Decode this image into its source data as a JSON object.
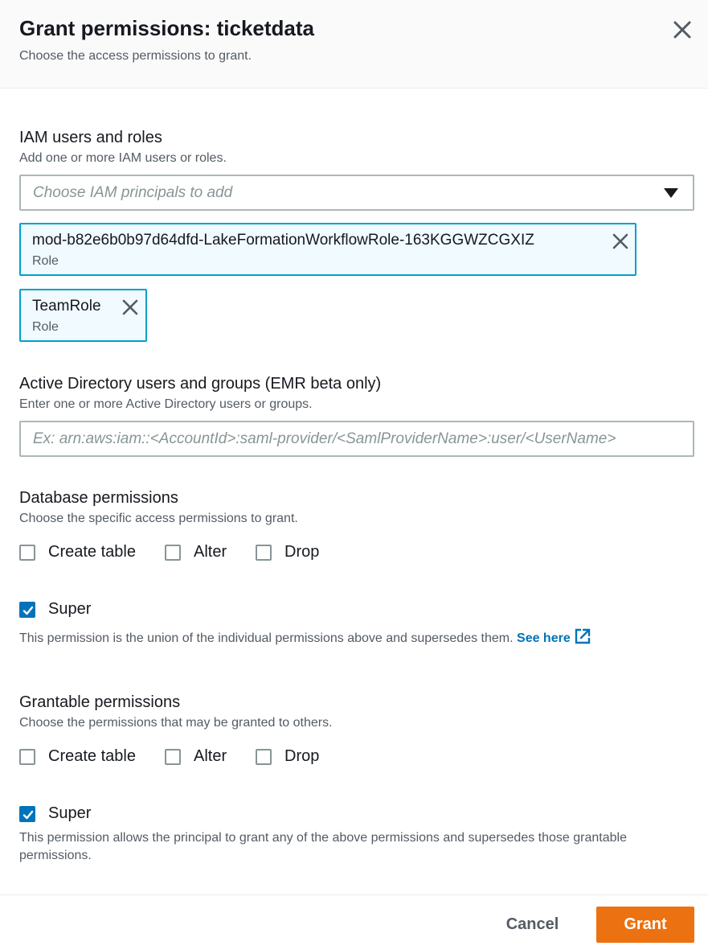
{
  "modal": {
    "title": "Grant permissions: ticketdata",
    "subtitle": "Choose the access permissions to grant."
  },
  "iam": {
    "label": "IAM users and roles",
    "description": "Add one or more IAM users or roles.",
    "placeholder": "Choose IAM principals to add",
    "tokens": [
      {
        "name": "mod-b82e6b0b97d64dfd-LakeFormationWorkflowRole-163KGGWZCGXIZ",
        "type": "Role"
      },
      {
        "name": "TeamRole",
        "type": "Role"
      }
    ]
  },
  "active_directory": {
    "label": "Active Directory users and groups (EMR beta only)",
    "description": "Enter one or more Active Directory users or groups.",
    "placeholder": "Ex: arn:aws:iam::<AccountId>:saml-provider/<SamlProviderName>:user/<UserName>"
  },
  "database_permissions": {
    "label": "Database permissions",
    "description": "Choose the specific access permissions to grant.",
    "options": [
      {
        "label": "Create table",
        "checked": false
      },
      {
        "label": "Alter",
        "checked": false
      },
      {
        "label": "Drop",
        "checked": false
      }
    ],
    "super": {
      "label": "Super",
      "checked": true
    },
    "super_note": "This permission is the union of the individual permissions above and supersedes them.",
    "see_here": "See here"
  },
  "grantable_permissions": {
    "label": "Grantable permissions",
    "description": "Choose the permissions that may be granted to others.",
    "options": [
      {
        "label": "Create table",
        "checked": false
      },
      {
        "label": "Alter",
        "checked": false
      },
      {
        "label": "Drop",
        "checked": false
      }
    ],
    "super": {
      "label": "Super",
      "checked": true
    },
    "super_note": "This permission allows the principal to grant any of the above permissions and supersedes those grantable permissions."
  },
  "footer": {
    "cancel_label": "Cancel",
    "grant_label": "Grant"
  },
  "colors": {
    "accent": "#0073bb",
    "token_border": "#00a1c9",
    "primary_button": "#ec7211"
  },
  "icons": {
    "close": "close-icon",
    "dropdown": "caret-down-icon",
    "remove_token": "close-icon",
    "checkbox_checked": "check-icon",
    "external_link": "external-link-icon"
  }
}
